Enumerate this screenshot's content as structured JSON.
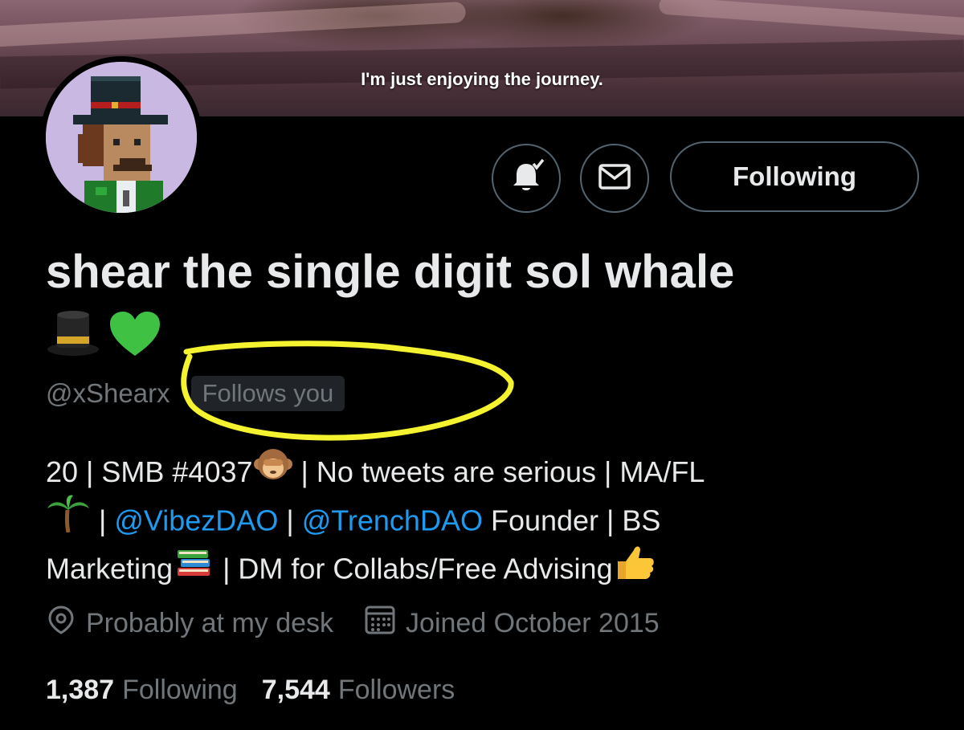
{
  "banner": {
    "caption": "I'm just enjoying the journey."
  },
  "actions": {
    "notify_icon": "bell-check-icon",
    "message_icon": "envelope-icon",
    "follow_label": "Following"
  },
  "profile": {
    "display_name": "shear the single digit sol whale",
    "name_emojis": "🎩💚",
    "handle": "@xShearx",
    "follows_you": "Follows you"
  },
  "bio": {
    "line1_a": "20 | SMB #4037",
    "line1_b": " | No tweets are serious | MA/FL",
    "line2_sep1": " | ",
    "mention1": "@VibezDAO",
    "line2_sep2": " | ",
    "mention2": "@TrenchDAO",
    "line2_tail": " Founder | BS",
    "line3_a": "Marketing",
    "line3_b": " | DM for Collabs/Free Advising"
  },
  "meta": {
    "location": "Probably at my desk",
    "joined": "Joined October 2015"
  },
  "stats": {
    "following_count": "1,387",
    "following_label": "Following",
    "followers_count": "7,544",
    "followers_label": "Followers"
  },
  "colors": {
    "background": "#000000",
    "text": "#e7e9ea",
    "secondary": "#71767b",
    "link": "#1d9bf0",
    "border": "#536471",
    "annotation": "#f5f230"
  }
}
